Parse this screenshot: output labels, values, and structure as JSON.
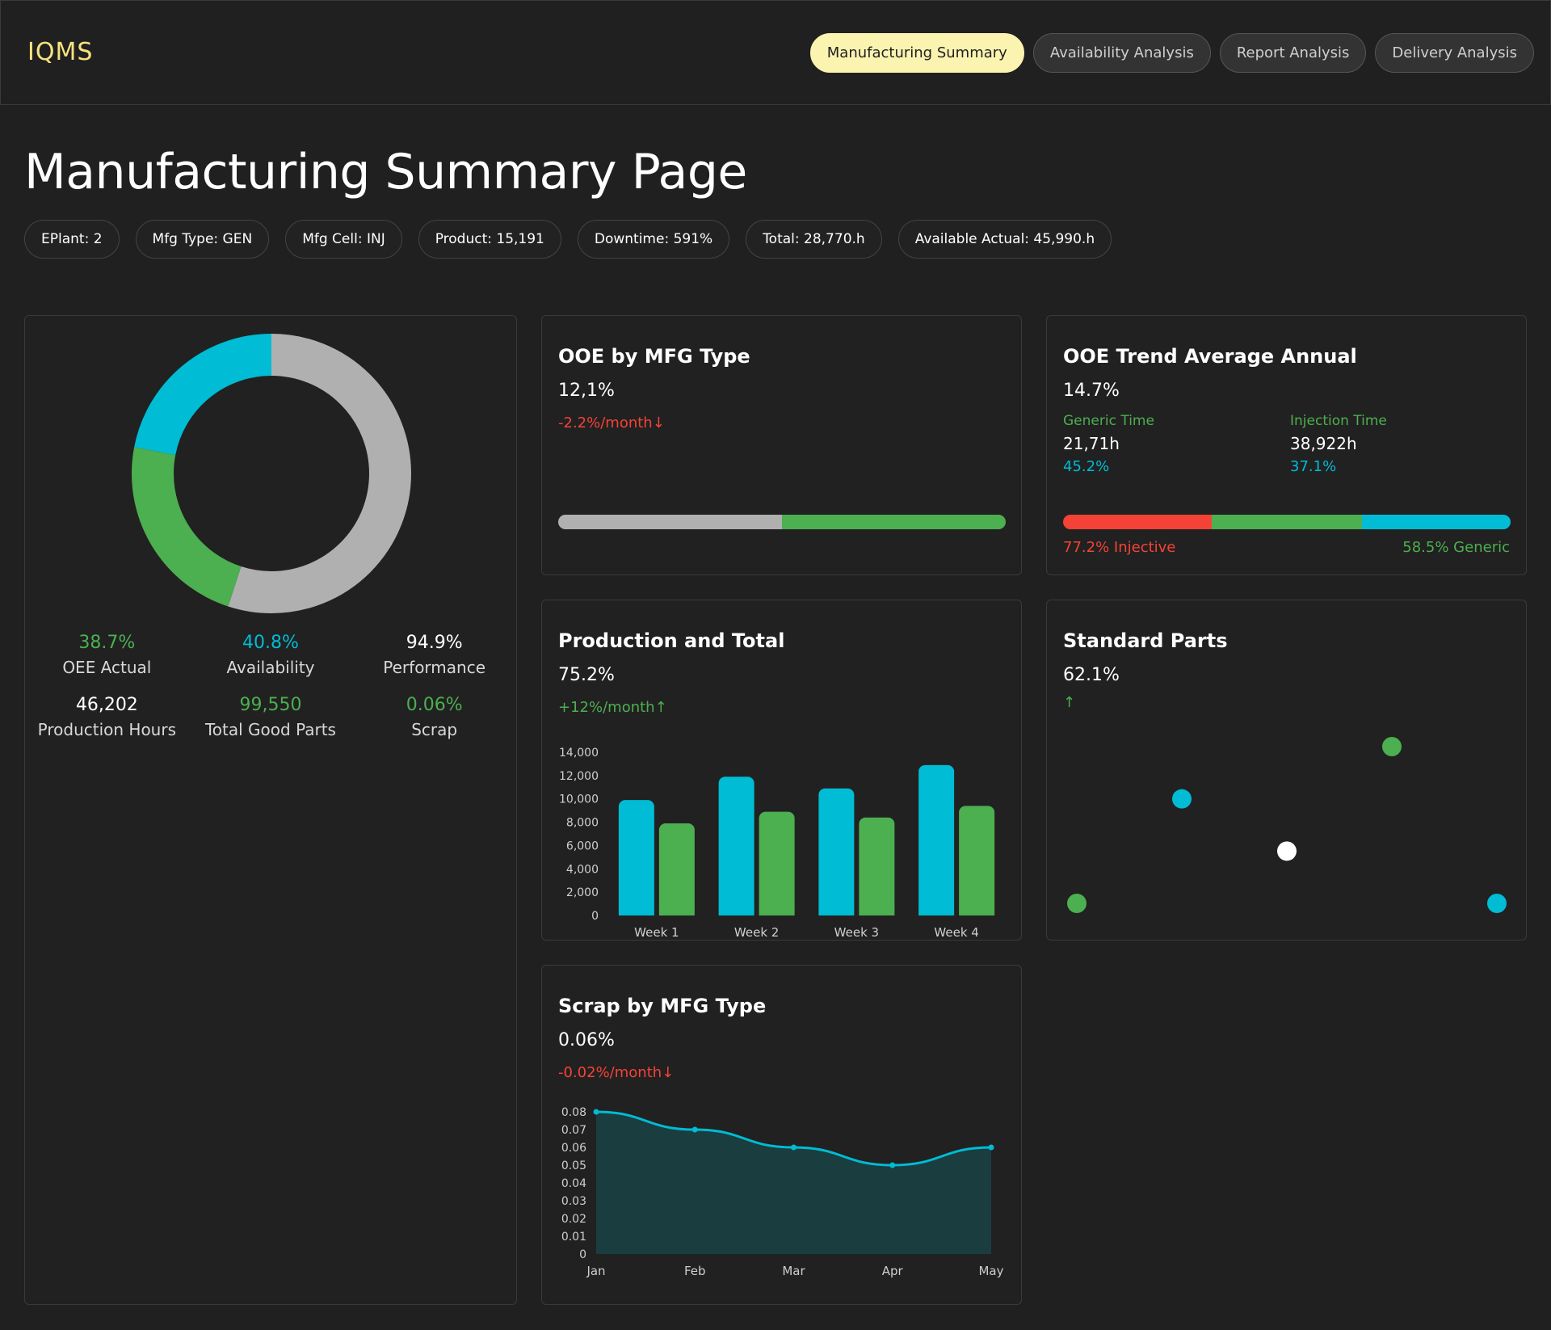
{
  "app": {
    "logo": "IQMS"
  },
  "tabs": [
    {
      "label": "Manufacturing Summary",
      "active": true
    },
    {
      "label": "Availability Analysis",
      "active": false
    },
    {
      "label": "Report Analysis",
      "active": false
    },
    {
      "label": "Delivery Analysis",
      "active": false
    }
  ],
  "page": {
    "title": "Manufacturing Summary Page"
  },
  "chips": [
    "EPlant: 2",
    "Mfg Type: GEN",
    "Mfg Cell: INJ",
    "Product: 15,191",
    "Downtime: 591%",
    "Total: 28,770.h",
    "Available Actual: 45,990.h"
  ],
  "summary": {
    "donut": {
      "segments": [
        {
          "value": 0.55,
          "color": "#b0b0b0"
        },
        {
          "value": 0.23,
          "color": "#4caf50"
        },
        {
          "value": 0.22,
          "color": "#00bcd4"
        }
      ]
    },
    "stats": [
      {
        "value": "38.7%",
        "label": "OEE Actual",
        "color": "#4caf50"
      },
      {
        "value": "40.8%",
        "label": "Availability",
        "color": "#00bcd4"
      },
      {
        "value": "94.9%",
        "label": "Performance",
        "color": "#ffffff"
      },
      {
        "value": "46,202",
        "label": "Production Hours",
        "color": "#ffffff"
      },
      {
        "value": "99,550",
        "label": "Total Good Parts",
        "color": "#4caf50"
      },
      {
        "value": "0.06%",
        "label": "Scrap",
        "color": "#4caf50"
      }
    ]
  },
  "ooe_mfg": {
    "title": "OOE by MFG Type",
    "value": "12,1%",
    "trend": "-2.2%/month",
    "trend_icon": "arrow-down-icon",
    "bar": [
      {
        "fraction": 0.5,
        "color": "#b0b0b0"
      },
      {
        "fraction": 0.5,
        "color": "#4caf50"
      }
    ]
  },
  "ooe_trend": {
    "title": "OOE Trend Average Annual",
    "value": "14.7%",
    "generic": {
      "label": "Generic Time",
      "hours": "21,71h",
      "pct": "45.2%"
    },
    "injection": {
      "label": "Injection Time",
      "hours": "38,922h",
      "pct": "37.1%"
    },
    "bar": [
      {
        "fraction": 0.333,
        "color": "#f44336"
      },
      {
        "fraction": 0.334,
        "color": "#4caf50"
      },
      {
        "fraction": 0.333,
        "color": "#00bcd4"
      }
    ],
    "left_caption": "77.2% Injective",
    "right_caption": "58.5% Generic"
  },
  "production": {
    "title": "Production and Total",
    "value": "75.2%",
    "trend": "+12%/month",
    "trend_icon": "arrow-up-icon"
  },
  "standard_parts": {
    "title": "Standard Parts",
    "value": "62.1%",
    "trend_icon": "arrow-up-icon"
  },
  "scrap": {
    "title": "Scrap by MFG Type",
    "value": "0.06%",
    "trend": "-0.02%/month",
    "trend_icon": "arrow-down-icon"
  },
  "chart_data": [
    {
      "type": "bar",
      "categories": [
        "Week 1",
        "Week 2",
        "Week 3",
        "Week 4"
      ],
      "series": [
        {
          "values": [
            9900,
            11900,
            10900,
            12900
          ],
          "color": "#00bcd4"
        },
        {
          "values": [
            7900,
            8900,
            8400,
            9400
          ],
          "color": "#4caf50"
        }
      ],
      "yticks": [
        "0",
        "2,000",
        "4,000",
        "6,000",
        "8,000",
        "10,000",
        "12,000",
        "14,000"
      ],
      "ylim": [
        0,
        14000
      ],
      "grid": false
    },
    {
      "type": "scatter",
      "points": [
        {
          "x": 0,
          "y": 0,
          "color": "#4caf50"
        },
        {
          "x": 1,
          "y": 2,
          "color": "#00bcd4"
        },
        {
          "x": 2,
          "y": 1,
          "color": "#ffffff"
        },
        {
          "x": 3,
          "y": 3,
          "color": "#4caf50"
        },
        {
          "x": 4,
          "y": 0,
          "color": "#00bcd4"
        }
      ],
      "xlim": [
        0,
        4
      ],
      "ylim": [
        0,
        3
      ]
    },
    {
      "type": "area",
      "categories": [
        "Jan",
        "Feb",
        "Mar",
        "Apr",
        "May"
      ],
      "values": [
        0.08,
        0.07,
        0.06,
        0.05,
        0.06
      ],
      "yticks": [
        "0",
        "0.01",
        "0.02",
        "0.03",
        "0.04",
        "0.05",
        "0.06",
        "0.07",
        "0.08"
      ],
      "ylim": [
        0,
        0.08
      ],
      "line_color": "#00bcd4",
      "fill_color": "#1a3d40"
    }
  ]
}
